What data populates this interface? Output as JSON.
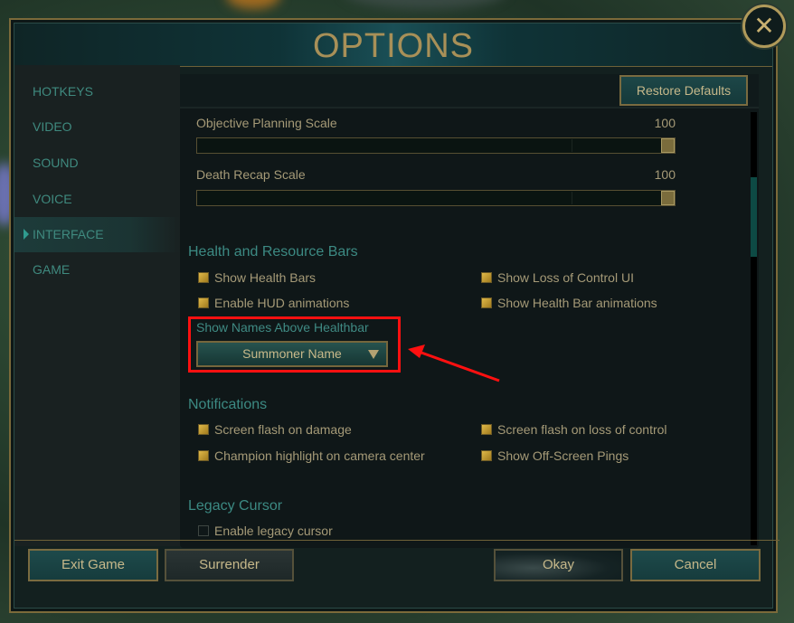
{
  "window": {
    "title": "OPTIONS",
    "close_icon": "close-icon"
  },
  "sidebar": {
    "items": [
      {
        "label": "HOTKEYS",
        "active": false
      },
      {
        "label": "VIDEO",
        "active": false
      },
      {
        "label": "SOUND",
        "active": false
      },
      {
        "label": "VOICE",
        "active": false
      },
      {
        "label": "INTERFACE",
        "active": true
      },
      {
        "label": "GAME",
        "active": false
      }
    ]
  },
  "content": {
    "restore_defaults_label": "Restore Defaults",
    "sliders": [
      {
        "label": "Objective Planning Scale",
        "value": "100",
        "percent": 100
      },
      {
        "label": "Death Recap Scale",
        "value": "100",
        "percent": 100
      }
    ],
    "sections": {
      "health": {
        "title": "Health and Resource Bars",
        "checkboxes": [
          {
            "label": "Show Health Bars",
            "checked": true
          },
          {
            "label": "Show Loss of Control UI",
            "checked": true
          },
          {
            "label": "Enable HUD animations",
            "checked": true
          },
          {
            "label": "Show Health Bar animations",
            "checked": true
          }
        ],
        "names_label": "Show Names Above Healthbar",
        "names_value": "Summoner Name"
      },
      "notifications": {
        "title": "Notifications",
        "checkboxes": [
          {
            "label": "Screen flash on damage",
            "checked": true
          },
          {
            "label": "Screen flash on loss of control",
            "checked": true
          },
          {
            "label": "Champion highlight on camera center",
            "checked": true
          },
          {
            "label": "Show Off-Screen Pings",
            "checked": true
          }
        ]
      },
      "legacy": {
        "title": "Legacy Cursor",
        "checkboxes": [
          {
            "label": "Enable legacy cursor",
            "checked": false
          }
        ]
      }
    }
  },
  "footer": {
    "exit_label": "Exit Game",
    "surrender_label": "Surrender",
    "okay_label": "Okay",
    "cancel_label": "Cancel"
  },
  "annotation": {
    "highlight_color": "#ff1010"
  }
}
